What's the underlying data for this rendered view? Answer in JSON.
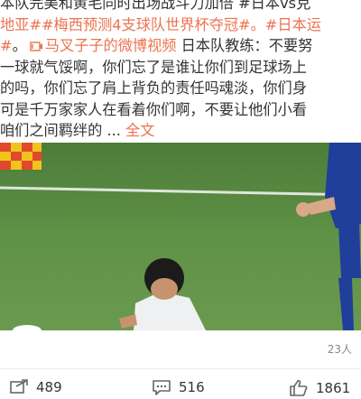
{
  "post": {
    "line1": "本队完美和黄毛同时出场战斗力加倍 #日本vs克",
    "line2": "地亚##梅西预测4支球队世界杯夺冠#。#日本运",
    "line3_tag": "#",
    "line3_dot": "。",
    "line3_link": "马叉子子的微博视频",
    "line3_rest": " 日本队教练：不要努",
    "line4": "一球就气馁啊，你们忘了是谁让你们到足球场上",
    "line5": "的吗，你们忘了肩上背负的责任吗魂淡，你们身",
    "line6": "可是千万家家人在看着你们啊，不要让他们小看",
    "line7": "咱们之间羁绊的 ... ",
    "fulltext": "全文"
  },
  "video": {
    "views": "23人"
  },
  "actions": {
    "repost": "489",
    "comment": "516",
    "like": "1861"
  },
  "colors": {
    "accent": "#eb7350",
    "text": "#333333",
    "muted": "#888888"
  },
  "icons": [
    "link-video-icon",
    "repost-icon",
    "comment-icon",
    "like-icon"
  ]
}
